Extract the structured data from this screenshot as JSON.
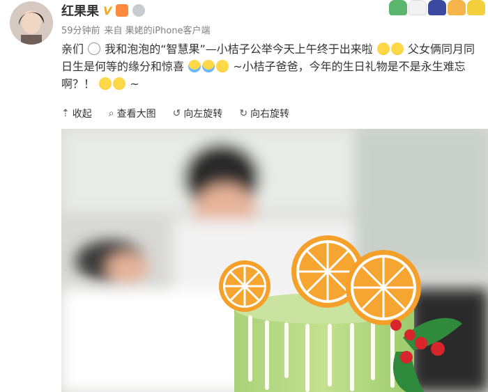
{
  "user": {
    "name": "红果果",
    "verified_mark": "V",
    "avatar_icon": "avatar-icon"
  },
  "meta": {
    "time": "59分钟前",
    "source": "来自 果姥的iPhone客户端"
  },
  "post": {
    "text_parts": [
      "亲们",
      "我和泡泡的“智慧果”—小桔子公举今天上午终于出来啦",
      "父女俩同月同日生是何等的缘分和惊喜",
      "~小桔子爸爸，今年的生日礼物是不是永生难忘啊？！",
      "~"
    ]
  },
  "toolbar": {
    "collapse": "收起",
    "view_large": "查看大图",
    "rotate_left": "向左旋转",
    "rotate_right": "向右旋转"
  },
  "photo": {
    "description_icon": "photo-image"
  }
}
